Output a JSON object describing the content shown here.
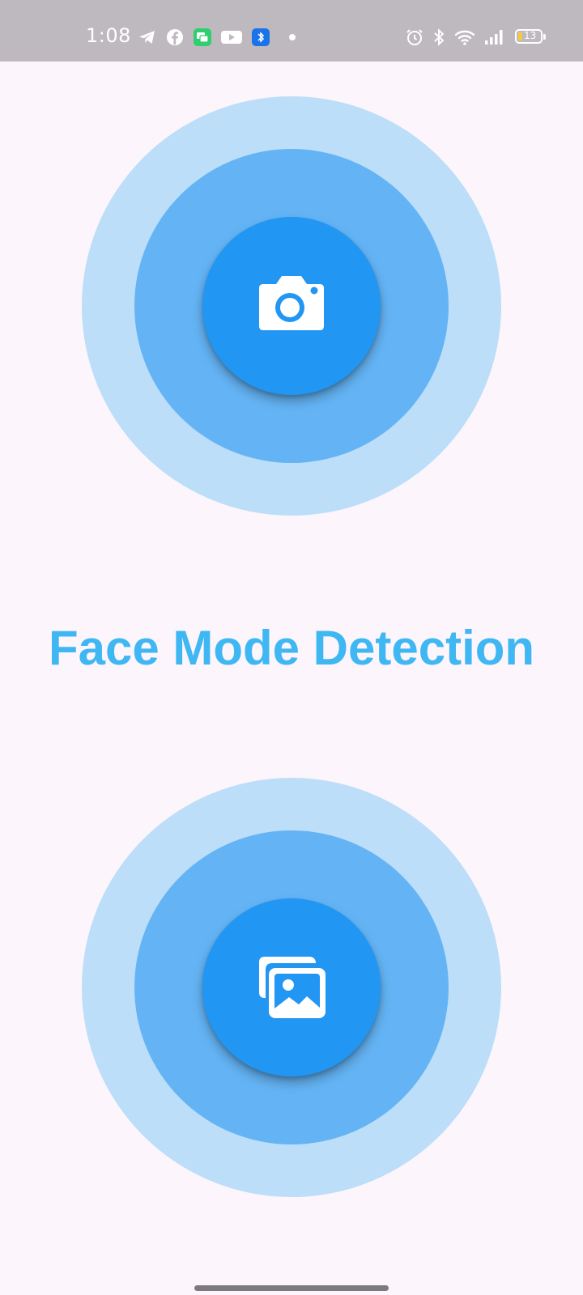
{
  "status_bar": {
    "time": "1:08",
    "battery_level": "13",
    "notification_icons": [
      "telegram-icon",
      "facebook-icon",
      "messaging-icon",
      "youtube-icon",
      "bluetooth-app-icon",
      "more-dot-icon"
    ],
    "system_icons": [
      "alarm-icon",
      "bluetooth-icon",
      "wifi-icon",
      "signal-icon",
      "battery-icon"
    ],
    "background_color": "#beb9be"
  },
  "main": {
    "title": "Face Mode Detection",
    "title_color": "#3fb7f3",
    "actions": [
      {
        "name": "camera-button",
        "icon": "camera-icon"
      },
      {
        "name": "gallery-button",
        "icon": "gallery-icon"
      }
    ],
    "colors": {
      "ring_outer": "#bcdef8",
      "ring_middle": "#64b4f5",
      "ring_inner": "#2196f3",
      "background": "#fcf5fc"
    }
  }
}
